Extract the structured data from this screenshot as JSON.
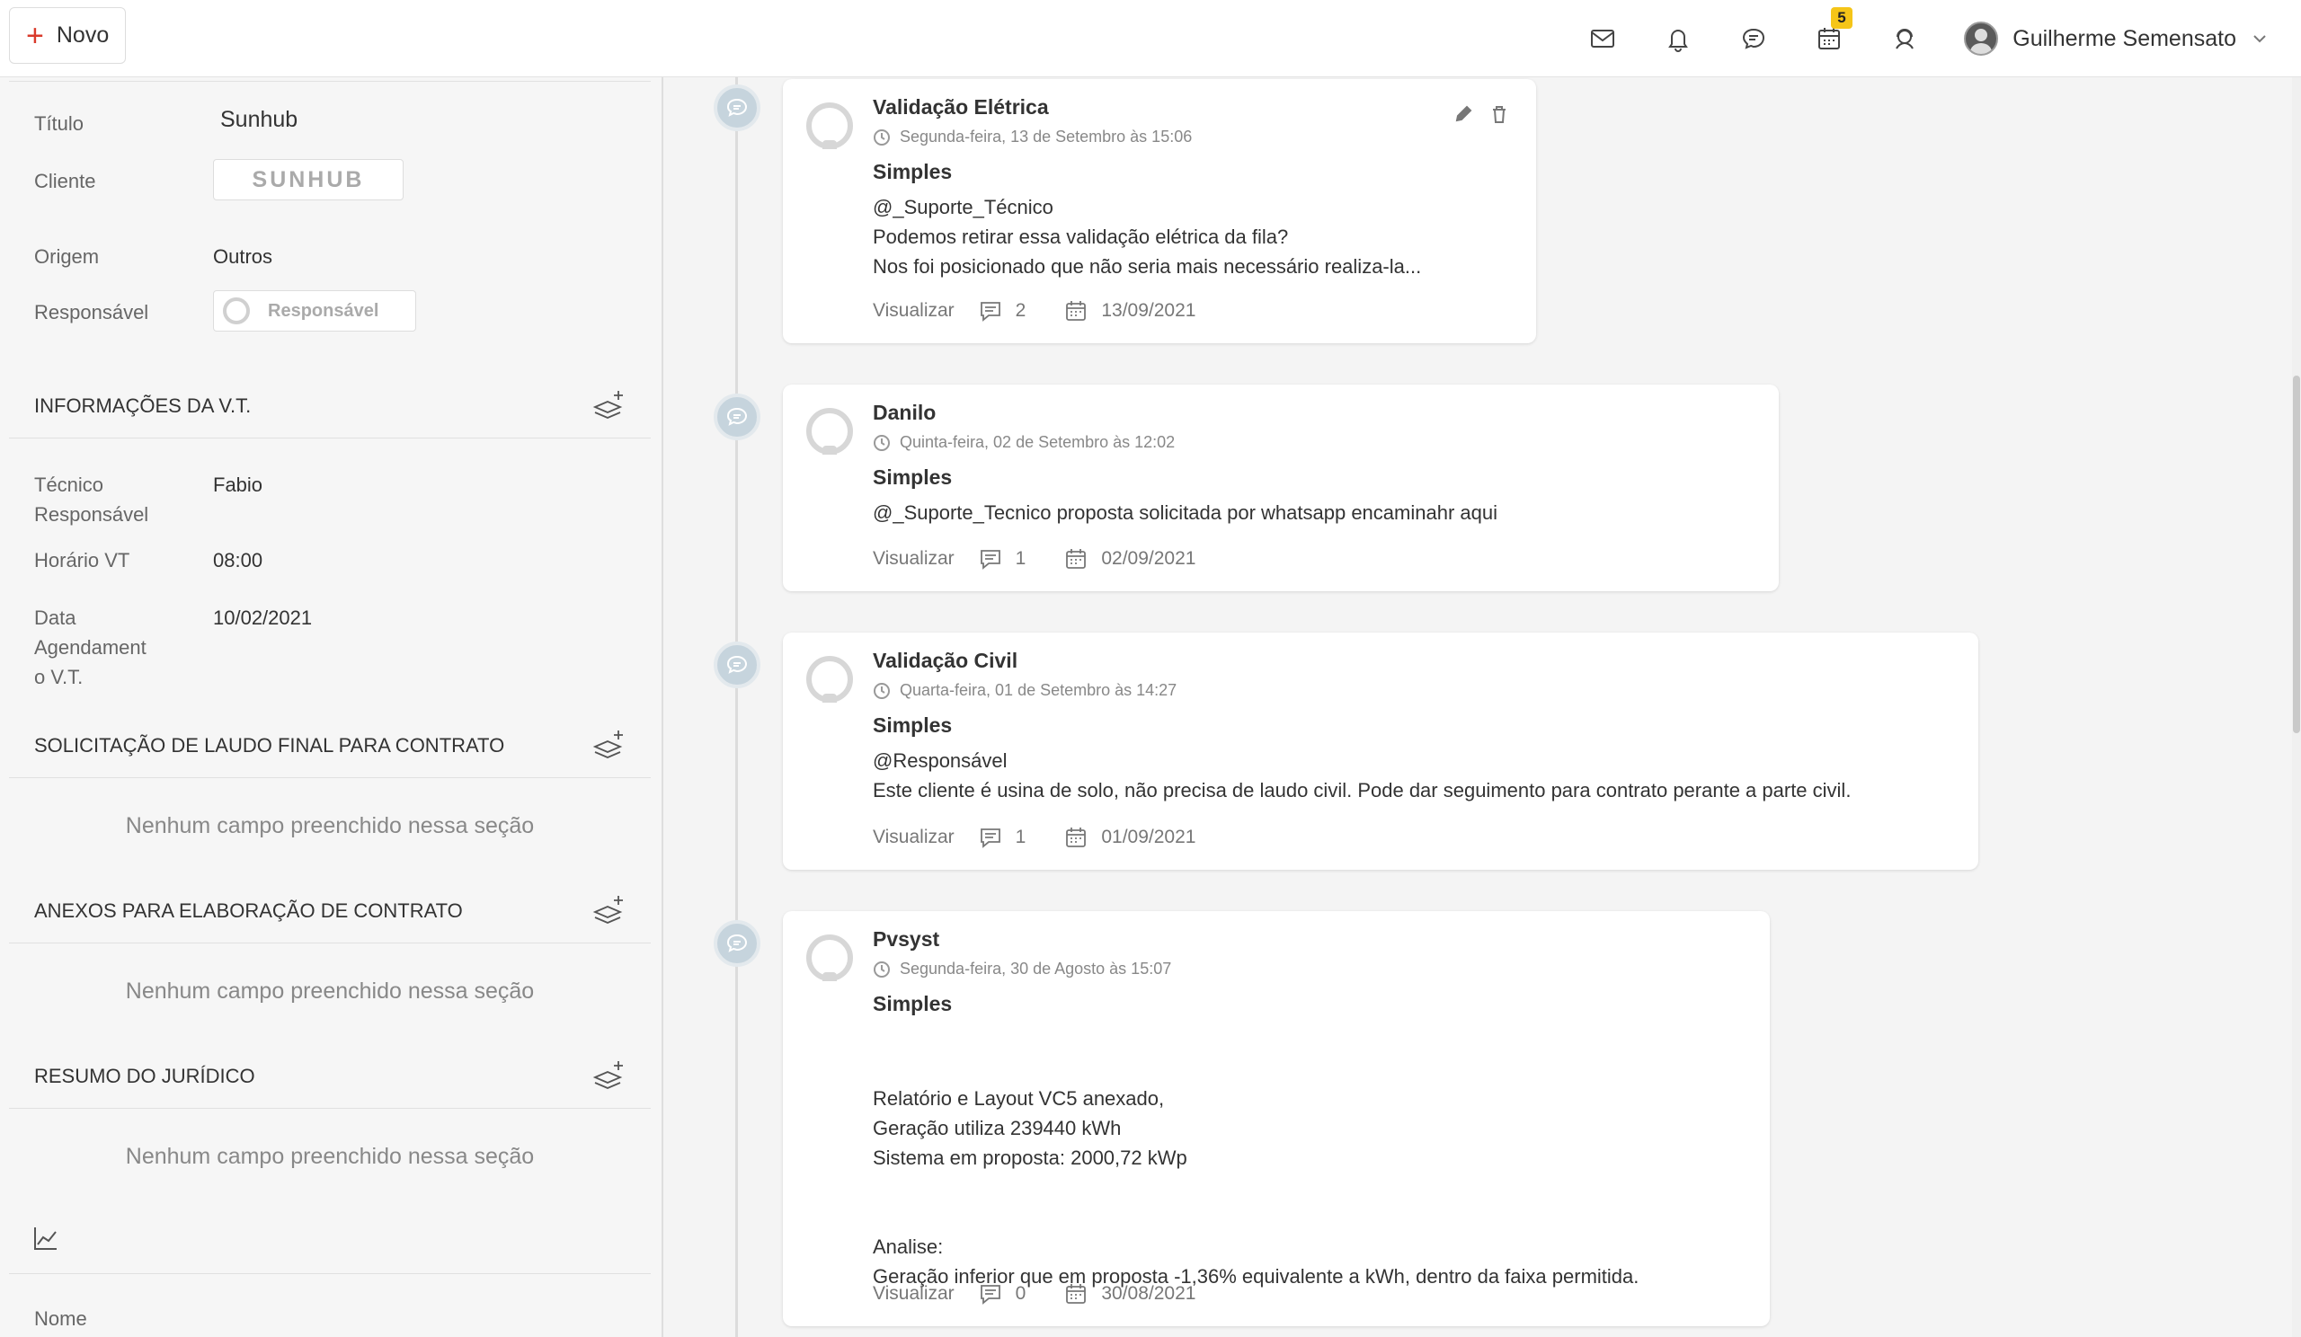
{
  "topbar": {
    "new_label": "Novo",
    "calendar_badge": "5",
    "user_name": "Guilherme Semensato",
    "icons": [
      "mail-icon",
      "bell-icon",
      "chat-icon",
      "calendar-icon",
      "support-icon"
    ]
  },
  "left": {
    "fields": {
      "titulo_label": "Título",
      "titulo_value": "Sunhub",
      "cliente_label": "Cliente",
      "cliente_logo": "SUNHUB",
      "origem_label": "Origem",
      "origem_value": "Outros",
      "responsavel_label": "Responsável",
      "responsavel_value": "Responsável"
    },
    "vt": {
      "heading": "INFORMAÇÕES DA V.T.",
      "tecnico_label": "Técnico\nResponsável",
      "tecnico_value": "Fabio",
      "horario_label": "Horário VT",
      "horario_value": "08:00",
      "data_label": "Data\nAgendament\no V.T.",
      "data_value": "10/02/2021"
    },
    "sections": [
      {
        "heading": "SOLICITAÇÃO DE LAUDO FINAL PARA CONTRATO",
        "empty": "Nenhum campo preenchido nessa seção"
      },
      {
        "heading": "ANEXOS PARA ELABORAÇÃO DE CONTRATO",
        "empty": "Nenhum campo preenchido nessa seção"
      },
      {
        "heading": "RESUMO DO JURÍDICO",
        "empty": "Nenhum campo preenchido nessa seção"
      }
    ],
    "nome_label": "Nome"
  },
  "timeline": [
    {
      "title": "Validação Elétrica",
      "date": "Segunda-feira, 13 de Setembro às 15:06",
      "type": "Simples",
      "body": "@_Suporte_Técnico\nPodemos retirar essa validação elétrica da fila?\nNos foi posicionado que não seria mais necessário realiza-la...",
      "view": "Visualizar",
      "comments": "2",
      "due": "13/09/2021"
    },
    {
      "title": "Danilo",
      "date": "Quinta-feira, 02 de Setembro às 12:02",
      "type": "Simples",
      "body": "@_Suporte_Tecnico proposta solicitada por whatsapp encaminahr aqui",
      "view": "Visualizar",
      "comments": "1",
      "due": "02/09/2021"
    },
    {
      "title": "Validação Civil",
      "date": "Quarta-feira, 01 de Setembro às 14:27",
      "type": "Simples",
      "body": "@Responsável\nEste cliente é usina de solo, não precisa de laudo civil. Pode dar seguimento para contrato perante a parte civil.",
      "view": "Visualizar",
      "comments": "1",
      "due": "01/09/2021"
    },
    {
      "title": "Pvsyst",
      "date": "Segunda-feira, 30 de Agosto às 15:07",
      "type": "Simples",
      "body": "\n\nRelatório e Layout VC5 anexado,\nGeração utiliza 239440 kWh\nSistema em proposta: 2000,72 kWp\n\n\nAnalise:\nGeração inferior que em proposta -1,36% equivalente a kWh, dentro da faixa permitida.",
      "view": "Visualizar",
      "comments": "0",
      "due": "30/08/2021"
    }
  ]
}
